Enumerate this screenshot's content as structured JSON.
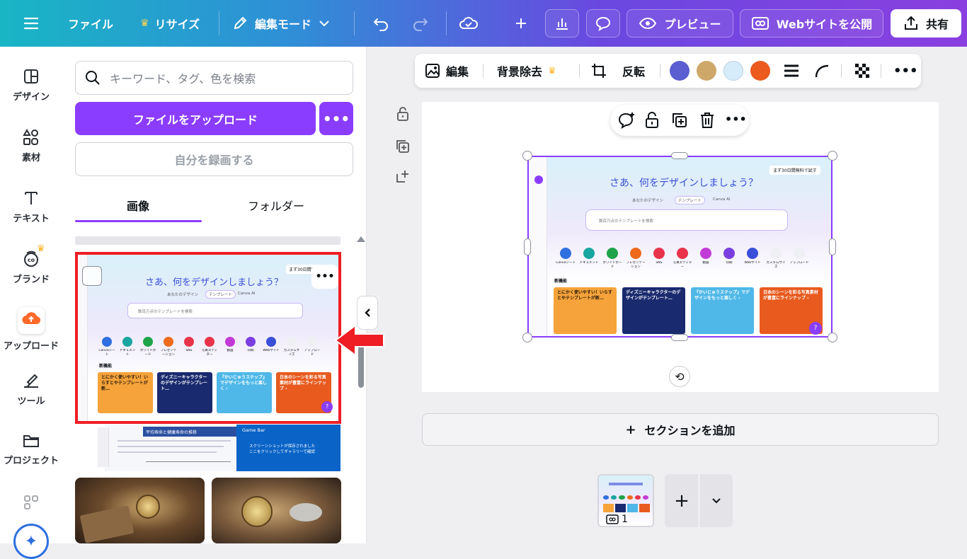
{
  "topbar": {
    "file": "ファイル",
    "resize": "リサイズ",
    "edit_mode": "編集モード",
    "preview": "プレビュー",
    "publish": "Webサイトを公開",
    "share": "共有"
  },
  "leftnav": {
    "items": [
      {
        "label": "デザイン",
        "icon": "design-icon"
      },
      {
        "label": "素材",
        "icon": "elements-icon"
      },
      {
        "label": "テキスト",
        "icon": "text-icon"
      },
      {
        "label": "ブランド",
        "icon": "brand-icon"
      },
      {
        "label": "アップロード",
        "icon": "upload-icon"
      },
      {
        "label": "ツール",
        "icon": "tools-icon"
      },
      {
        "label": "プロジェクト",
        "icon": "folder-icon"
      }
    ]
  },
  "panel": {
    "search_placeholder": "キーワード、タグ、色を検索",
    "upload_button": "ファイルをアップロード",
    "more": "•••",
    "record_button": "自分を録画する",
    "tab_images": "画像",
    "tab_folders": "フォルダー"
  },
  "mock": {
    "headline": "さあ、何をデザインしましょう？",
    "trial": "まず30日間無料で試す",
    "search": "数百万点のテンプレートを検索",
    "tab_design": "あなたのデザイン",
    "tab_template": "テンプレート",
    "tab_ai": "Canva AI",
    "new": "新機能",
    "categories": [
      "Canvaシート",
      "ドキュメント",
      "ホワイトボード",
      "プレゼンテーション",
      "SNS",
      "写真エディター",
      "動画",
      "印刷",
      "Webサイト",
      "カスタムサイズ",
      "アップロード"
    ],
    "cards": [
      "とにかく使いやすい！いらすとやテンプレートが新…",
      "ディズニーキャラクターのデザインがテンプレート…",
      "『かいじゅうステップ』でデザインをもっと楽しく ›",
      "日本のシーンを彩る写真素材が豊富にラインナップ ›"
    ],
    "category_colors": [
      "#2f6fe0",
      "#19a5a0",
      "#1fa34a",
      "#f06a1c",
      "#e8344a",
      "#e8344a",
      "#c23ad6",
      "#7b3fe0",
      "#3a4fd8",
      "#8a8f98",
      "#8a8f98"
    ],
    "card_colors": [
      "#f5a33a",
      "#1a2a6e",
      "#4fb8e8",
      "#e85a1e"
    ]
  },
  "gamebar": {
    "title": "Game Bar",
    "text": "スクリーンショットが保存されました",
    "subtext": "ここをクリックしてギャラリーで確認",
    "doc_title": "平均寿命と健康寿命の推移"
  },
  "toolbar": {
    "edit": "編集",
    "bg_remove": "背景除去",
    "flip": "反転",
    "colors": [
      "#5a5ed0",
      "#cda86a",
      "#d6ecfb",
      "#ec5a1e"
    ]
  },
  "canvas": {
    "add_section": "セクションを追加"
  },
  "pages": {
    "page_number": "1"
  }
}
